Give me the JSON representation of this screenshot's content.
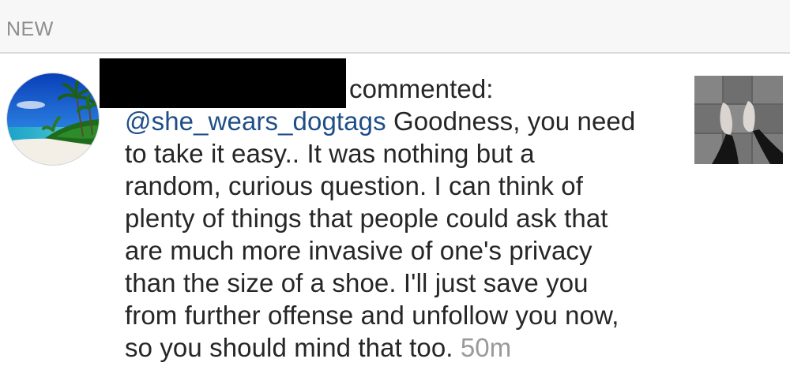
{
  "section": {
    "title": "NEW"
  },
  "notification": {
    "verb": "commented:",
    "mention": "@she_wears_dogtags",
    "lines": {
      "l1_rest": " Goodness, you need",
      "l2": "to take it easy.. It was nothing but a",
      "l3": "random, curious question. I can think of",
      "l4": "plenty of things that people could ask that",
      "l5": "are much more invasive of one's privacy",
      "l6": "than the size of a shoe. I'll just save you",
      "l7": "from further offense and unfollow you now,",
      "l8": "so you should mind that too."
    },
    "timestamp": "50m"
  },
  "icons": {
    "avatar": "beach-palm-avatar-icon",
    "thumbnail": "bare-feet-tile-floor-photo"
  },
  "colors": {
    "header_bg": "#f7f7f7",
    "header_text": "#8e8e8e",
    "body_text": "#262626",
    "mention": "#1f4e87",
    "timestamp": "#999999"
  }
}
